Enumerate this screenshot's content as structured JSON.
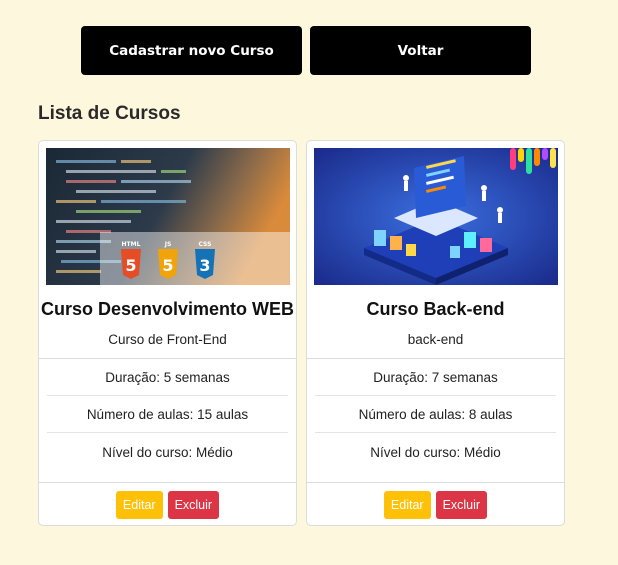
{
  "header": {
    "new_course_label": "Cadastrar novo Curso",
    "back_label": "Voltar"
  },
  "list_title": "Lista de Cursos",
  "courses": [
    {
      "title": "Curso Desenvolvimento WEB",
      "description": "Curso de Front-End",
      "image": "html-css-js-logos",
      "duration": "Duração: 5 semanas",
      "lessons": "Número de aulas: 15 aulas",
      "level": "Nível do curso: Médio",
      "edit_label": "Editar",
      "delete_label": "Excluir"
    },
    {
      "title": "Curso Back-end",
      "description": "back-end",
      "image": "isometric-laptop-server",
      "duration": "Duração: 7 semanas",
      "lessons": "Número de aulas: 8 aulas",
      "level": "Nível do curso: Médio",
      "edit_label": "Editar",
      "delete_label": "Excluir"
    }
  ],
  "colors": {
    "background": "#fdf7de",
    "primary_button": "#000000",
    "edit_button": "#ffc107",
    "delete_button": "#dc3545"
  }
}
